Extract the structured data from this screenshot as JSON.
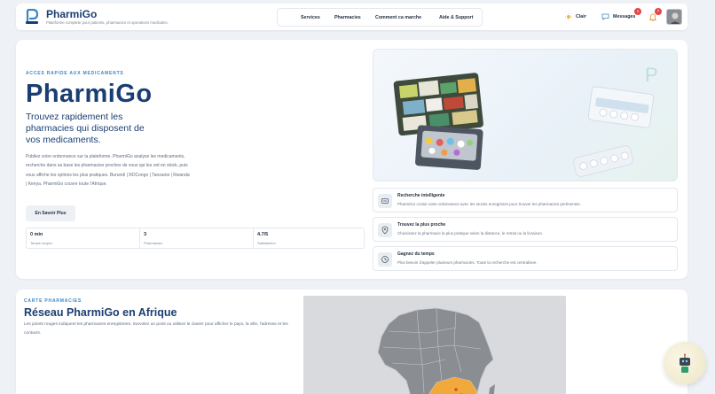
{
  "header": {
    "brand": "PharmiGo",
    "tagline": "Plateforme complete pour patients, pharmacies et operations medicales.",
    "nav": [
      "Services",
      "Pharmacies",
      "Comment ca marche",
      "Aide & Support"
    ],
    "theme_label": "Clair",
    "messages_label": "Messages",
    "messages_badge": "1",
    "notifications_badge": "7"
  },
  "hero": {
    "kicker": "ACCES RAPIDE AUX MEDICAMENTS",
    "title": "PharmiGo",
    "subtitle": "Trouvez rapidement les pharmacies qui disposent de vos medicaments.",
    "description": "Publiez votre ordonnance sur la plateforme. PharmiGo analyse les medicaments, recherche dans sa base les pharmacies proches de vous qui les ont en stock, puis vous affiche les options les plus pratiques. Burundi | RDCongo | Tanzanie | Rwanda | Kenya. PharmiGo couvre toute l'Afrique.",
    "button": "En Savoir Plus",
    "stats": [
      {
        "value": "0 min",
        "label": "Temps moyen"
      },
      {
        "value": "3",
        "label": "Pharmacies"
      },
      {
        "value": "4.7/5",
        "label": "Satisfaction"
      }
    ]
  },
  "features": [
    {
      "icon": "brain-icon",
      "title": "Recherche intelligente",
      "desc": "PharmiGo croise votre ordonnance avec les stocks enregistres pour trouver les pharmacies pertinentes."
    },
    {
      "icon": "location-pin-icon",
      "title": "Trouvez la plus proche",
      "desc": "Choisissez la pharmacie la plus pratique selon la distance, le retrait ou la livraison."
    },
    {
      "icon": "clock-icon",
      "title": "Gagnez du temps",
      "desc": "Plus besoin d'appeler plusieurs pharmacies. Toute la recherche est centralisee."
    }
  ],
  "map_section": {
    "kicker": "CARTE PHARMACIES",
    "title": "Réseau PharmiGo en Afrique",
    "description": "Les points rouges indiquent les pharmacies enregistrees. Survolez un point ou utilisez le clavier pour afficher le pays, la ville, l'adresse et les contacts."
  },
  "colors": {
    "brand": "#1b3e72",
    "accent": "#3b86c4",
    "badge": "#e64545",
    "highlight_region": "#f2a93b"
  }
}
